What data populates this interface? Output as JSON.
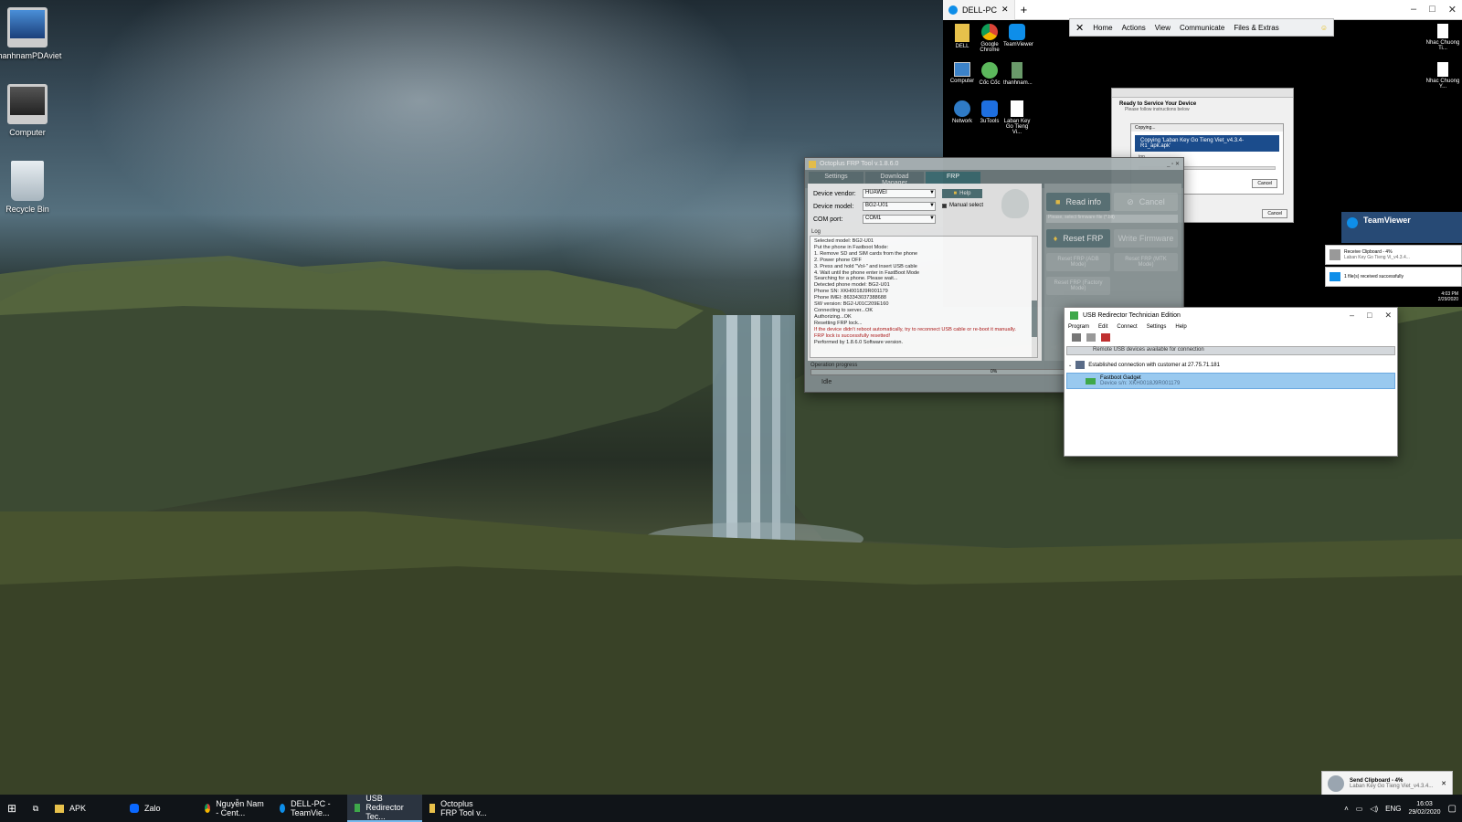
{
  "desktop": {
    "icons": [
      {
        "label": "thanhnamPDAviet"
      },
      {
        "label": "Computer"
      },
      {
        "label": "Recycle Bin"
      }
    ]
  },
  "teamviewer": {
    "tab_label": "DELL-PC",
    "toolbar": [
      "Home",
      "Actions",
      "View",
      "Communicate",
      "Files & Extras"
    ],
    "remote_icons": [
      "DELL",
      "Google Chrome",
      "TeamViewer",
      "Computer",
      "Cốc Cốc",
      "thanhnam...",
      "Network",
      "3uTools",
      "Laban Key Go Tieng Vi..."
    ],
    "right_icons": [
      "Nhac Chuong Ti...",
      "Nhac Chuong Y..."
    ],
    "redirector_dialog": {
      "heading": "Ready to Service Your Device",
      "sub": "Please follow instructions below",
      "copying_title": "Copying...",
      "copying_text": "Copying 'Laban Key Go Tieng Viet_v4.3.4-R1_apk.apk'",
      "copying_sub": "top",
      "cancel1": "Cancel",
      "cancel2": "Cancel"
    },
    "tv_panel": {
      "title": "TeamViewer",
      "notif1_title": "Receive Clipboard - 4%",
      "notif1_sub": "Laban Key Go Tieng Vi_v4.3.4...",
      "notif2_title": "1 file(s) received successfully"
    },
    "remote_clock": {
      "time": "4:03 PM",
      "date": "2/29/2020"
    }
  },
  "frp": {
    "title": "Octoplus FRP Tool v.1.8.6.0",
    "tabs": [
      "Settings",
      "Download Manager",
      "FRP"
    ],
    "vendor_label": "Device vendor:",
    "vendor_value": "HUAWEI",
    "model_label": "Device model:",
    "model_value": "BG2-U01",
    "com_label": "COM port:",
    "com_value": "COM1",
    "help": "Help",
    "manual": "Manual select",
    "log_label": "Log",
    "log_lines": [
      {
        "t": "Selected model: BG2-U01",
        "c": "#222"
      },
      {
        "t": "Put the phone in Fastboot Mode:",
        "c": "#222"
      },
      {
        "t": "1. Remove SD and SIM cards from the phone",
        "c": "#222"
      },
      {
        "t": "2. Power phone OFF",
        "c": "#222"
      },
      {
        "t": "3. Press and hold \"Vol-\" and insert USB cable",
        "c": "#222"
      },
      {
        "t": "4. Wait until the phone enter in FastBoot Mode",
        "c": "#222"
      },
      {
        "t": "Searching for a phone. Please wait...",
        "c": "#222"
      },
      {
        "t": "Detected phone model: BG2-U01",
        "c": "#222"
      },
      {
        "t": "Phone SN: XKH0018J9R001179",
        "c": "#222"
      },
      {
        "t": "Phone IMEI: 863343037388688",
        "c": "#222"
      },
      {
        "t": "SW version: BG2-U01C209E160",
        "c": "#222"
      },
      {
        "t": "Connecting to server...OK",
        "c": "#222"
      },
      {
        "t": "Authorizing...OK",
        "c": "#222"
      },
      {
        "t": "Resetting FRP lock...",
        "c": "#222"
      },
      {
        "t": "If the device didn't reboot automatically, try to reconnect USB cable or re-boot it manually.",
        "c": "#b01818"
      },
      {
        "t": "FRP lock is successfully resetted!",
        "c": "#b01818"
      },
      {
        "t": "Performed by 1.8.6.0 Software version.",
        "c": "#222"
      }
    ],
    "read_info": "Read info",
    "cancel": "Cancel",
    "firmware_placeholder": "Please, select firmware file (*.bit)",
    "reset_frp": "Reset FRP",
    "write_firmware": "Write Firmware",
    "reset_adb": "Reset FRP (ADB Mode)",
    "reset_mtk": "Reset FRP (MTK Mode)",
    "reset_factory": "Reset FRP (Factory Mode)",
    "op_progress": "Operation progress",
    "progress_text": "0%",
    "progress": 0,
    "status": "Idle"
  },
  "usb": {
    "title": "USB Redirector Technician Edition",
    "menu": [
      "Program",
      "Edit",
      "Connect",
      "Settings",
      "Help"
    ],
    "tab": "Remote USB devices available for connection",
    "connection": "Established connection with customer at 27.75.71.181",
    "device_name": "Fastboot Gadget",
    "device_sn": "Device s/n: XKH0018J9R001179"
  },
  "notification": {
    "title": "Send Clipboard - 4%",
    "sub": "Laban Key Go Tieng Viet_v4.3.4..."
  },
  "taskbar": {
    "items": [
      "APK",
      "Zalo",
      "Nguyễn Nam - Cent...",
      "DELL-PC - TeamVie...",
      "USB Redirector Tec...",
      "Octoplus FRP Tool v..."
    ],
    "lang": "ENG",
    "time": "16:03",
    "date": "29/02/2020"
  },
  "colors": {
    "tv_blue": "#0e8ee9",
    "frp_panel": "#7f8a8c",
    "frp_btn": "#5c7478",
    "selection": "#99c9ef",
    "taskbar": "#101418"
  }
}
